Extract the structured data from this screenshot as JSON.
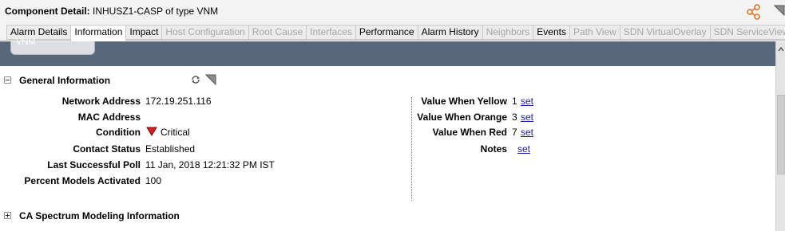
{
  "header": {
    "label": "Component Detail:",
    "component": "INHUSZ1-CASP of type VNM"
  },
  "tabs": [
    {
      "label": "Alarm Details",
      "state": "normal"
    },
    {
      "label": "Information",
      "state": "active"
    },
    {
      "label": "Impact",
      "state": "normal"
    },
    {
      "label": "Host Configuration",
      "state": "disabled"
    },
    {
      "label": "Root Cause",
      "state": "disabled"
    },
    {
      "label": "Interfaces",
      "state": "disabled"
    },
    {
      "label": "Performance",
      "state": "normal"
    },
    {
      "label": "Alarm History",
      "state": "normal"
    },
    {
      "label": "Neighbors",
      "state": "disabled"
    },
    {
      "label": "Events",
      "state": "normal"
    },
    {
      "label": "Path View",
      "state": "disabled"
    },
    {
      "label": "SDN VirtualOverlay",
      "state": "disabled"
    },
    {
      "label": "SDN ServiceView",
      "state": "disabled"
    }
  ],
  "banner": {
    "node_label": "VNM"
  },
  "general": {
    "title": "General Information",
    "fields": {
      "network_address": {
        "label": "Network Address",
        "value": "172.19.251.116"
      },
      "mac_address": {
        "label": "MAC Address",
        "value": ""
      },
      "condition": {
        "label": "Condition",
        "value": "Critical",
        "color": "#d42020"
      },
      "contact_status": {
        "label": "Contact Status",
        "value": "Established"
      },
      "last_poll": {
        "label": "Last Successful Poll",
        "value": "11 Jan, 2018 12:21:32 PM IST"
      },
      "percent_models": {
        "label": "Percent Models Activated",
        "value": "100"
      }
    },
    "right_fields": {
      "yellow": {
        "label": "Value When Yellow",
        "value": "1",
        "link": "set"
      },
      "orange": {
        "label": "Value When Orange",
        "value": "3",
        "link": "set"
      },
      "red": {
        "label": "Value When Red",
        "value": "7",
        "link": "set"
      },
      "notes": {
        "label": "Notes",
        "link": "set"
      }
    }
  },
  "modeling": {
    "title": "CA Spectrum Modeling Information"
  },
  "icons": {
    "share": "share-icon",
    "menu": "menu-triangle-icon",
    "refresh": "refresh-icon",
    "corner": "corner-triangle-icon",
    "collapse": "minus-box-icon",
    "expand": "plus-box-icon",
    "critical": "down-triangle-icon"
  }
}
